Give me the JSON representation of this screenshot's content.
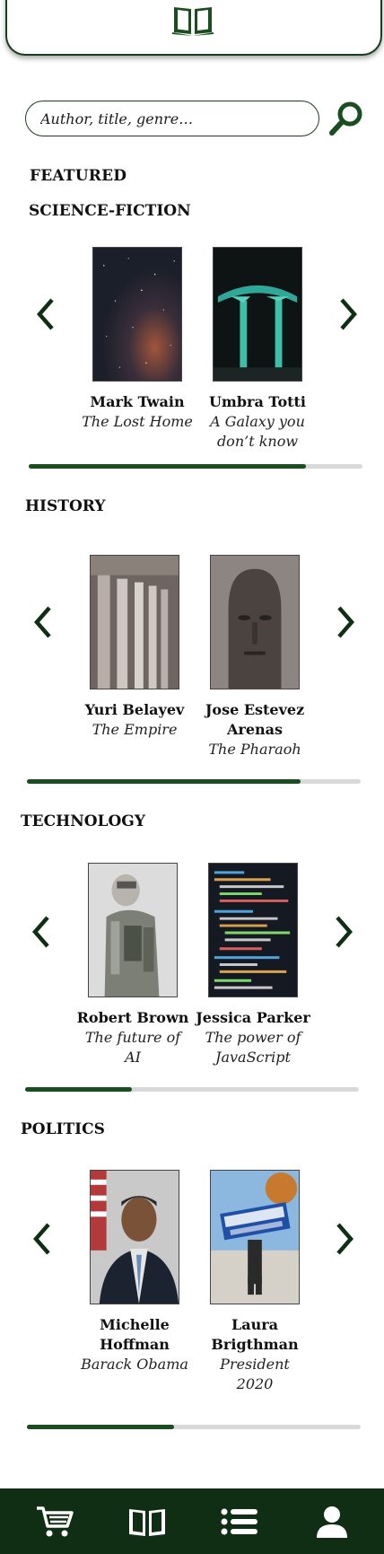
{
  "header": {
    "logo_icon": "open-book-icon"
  },
  "search": {
    "placeholder": "Author, title, genre…",
    "button_icon": "search-icon"
  },
  "featured_label": "FEATURED",
  "categories": [
    {
      "title": "SCIENCE-FICTION",
      "books": [
        {
          "author": "Mark Twain",
          "title": "The Lost Home"
        },
        {
          "author": "Umbra Totti",
          "title": "A Galaxy you don’t know"
        }
      ],
      "progress": 0.83
    },
    {
      "title": "HISTORY",
      "books": [
        {
          "author": "Yuri Belayev",
          "title": "The Empire"
        },
        {
          "author": "Jose Estevez Arenas",
          "title": "The Pharaoh"
        }
      ],
      "progress": 0.82
    },
    {
      "title": "TECHNOLOGY",
      "books": [
        {
          "author": "Robert Brown",
          "title": "The future of AI"
        },
        {
          "author": "Jessica Parker",
          "title": "The power of JavaScript"
        }
      ],
      "progress": 0.32
    },
    {
      "title": "POLITICS",
      "books": [
        {
          "author": "Michelle Hoffman",
          "title": "Barack Obama"
        },
        {
          "author": "Laura Brigthman",
          "title": "President 2020"
        }
      ],
      "progress": 0.44
    }
  ],
  "nav": {
    "items": [
      {
        "icon": "cart-icon"
      },
      {
        "icon": "book-icon"
      },
      {
        "icon": "list-icon"
      },
      {
        "icon": "user-icon"
      }
    ]
  },
  "colors": {
    "accent": "#1a4d1f",
    "nav_bg": "#0f2e13",
    "track": "#d9d9d9"
  }
}
